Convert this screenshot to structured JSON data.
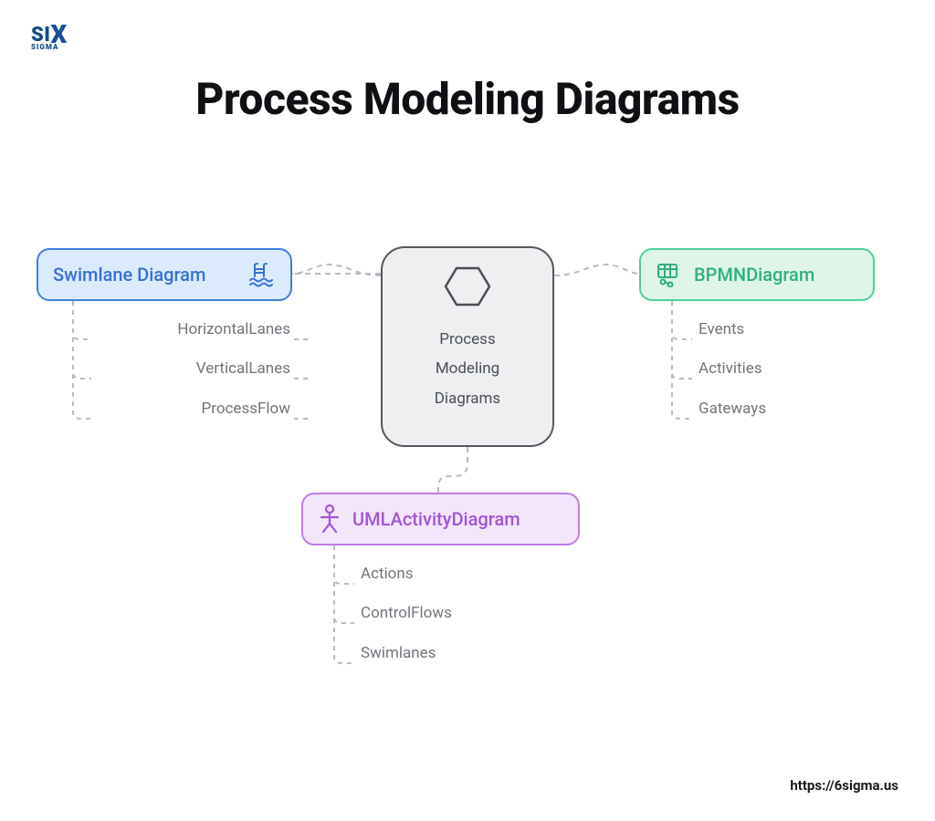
{
  "logo": {
    "text": "SIX",
    "sub": "SIGMA"
  },
  "title": "Process Modeling Diagrams",
  "center": {
    "line1": "Process",
    "line2": "Modeling",
    "line3": "Diagrams"
  },
  "branches": {
    "swimlane": {
      "label": "Swimlane Diagram",
      "items": [
        "HorizontalLanes",
        "VerticalLanes",
        "ProcessFlow"
      ],
      "color": "#3f7fe0"
    },
    "bpmn": {
      "label": "BPMNDiagram",
      "items": [
        "Events",
        "Activities",
        "Gateways"
      ],
      "color": "#4ed09a"
    },
    "uml": {
      "label": "UMLActivityDiagram",
      "items": [
        "Actions",
        "ControlFlows",
        "Swimlanes"
      ],
      "color": "#c07de8"
    }
  },
  "footer": {
    "url": "https://6sigma.us"
  }
}
